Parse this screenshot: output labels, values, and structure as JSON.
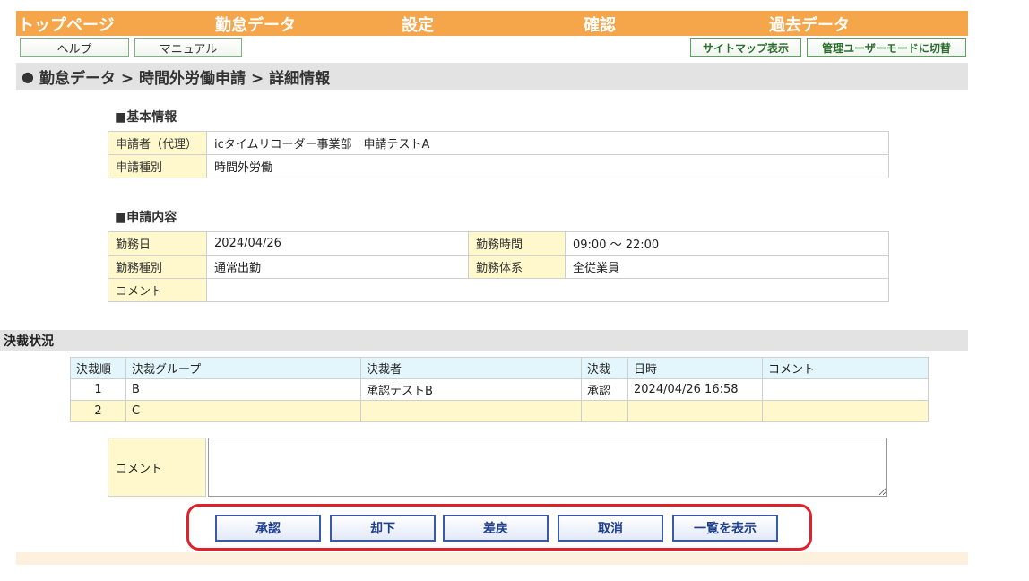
{
  "nav": {
    "items": [
      "トップページ",
      "勤怠データ",
      "設定",
      "確認",
      "過去データ"
    ]
  },
  "toolbar": {
    "help": "ヘルプ",
    "manual": "マニュアル",
    "sitemap": "サイトマップ表示",
    "admin_mode": "管理ユーザーモードに切替"
  },
  "breadcrumb": "勤怠データ > 時間外労働申請 > 詳細情報",
  "basic_info": {
    "heading": "■基本情報",
    "applicant_label": "申請者（代理）",
    "applicant_value": "icタイムリコーダー事業部　申請テストA",
    "type_label": "申請種別",
    "type_value": "時間外労働"
  },
  "request": {
    "heading": "■申請内容",
    "work_date_label": "勤務日",
    "work_date_value": "2024/04/26",
    "work_time_label": "勤務時間",
    "work_time_value": "09:00 ～ 22:00",
    "work_type_label": "勤務種別",
    "work_type_value": "通常出勤",
    "work_system_label": "勤務体系",
    "work_system_value": "全従業員",
    "comment_label": "コメント",
    "comment_value": ""
  },
  "approval": {
    "heading": "決裁状況",
    "columns": [
      "決裁順",
      "決裁グループ",
      "決裁者",
      "決裁",
      "日時",
      "コメント"
    ],
    "rows": [
      [
        "1",
        "B",
        "承認テストB",
        "承認",
        "2024/04/26 16:58",
        ""
      ],
      [
        "2",
        "C",
        "",
        "",
        "",
        ""
      ]
    ]
  },
  "comment_form": {
    "label": "コメント",
    "value": ""
  },
  "actions": {
    "approve": "承認",
    "reject": "却下",
    "return": "差戻",
    "cancel": "取消",
    "list": "一覧を表示"
  },
  "colors": {
    "nav_bg": "#f5a54a",
    "label_bg": "#fff8cc",
    "header_bg": "#e2f6fb",
    "highlight": "#e0202a"
  }
}
